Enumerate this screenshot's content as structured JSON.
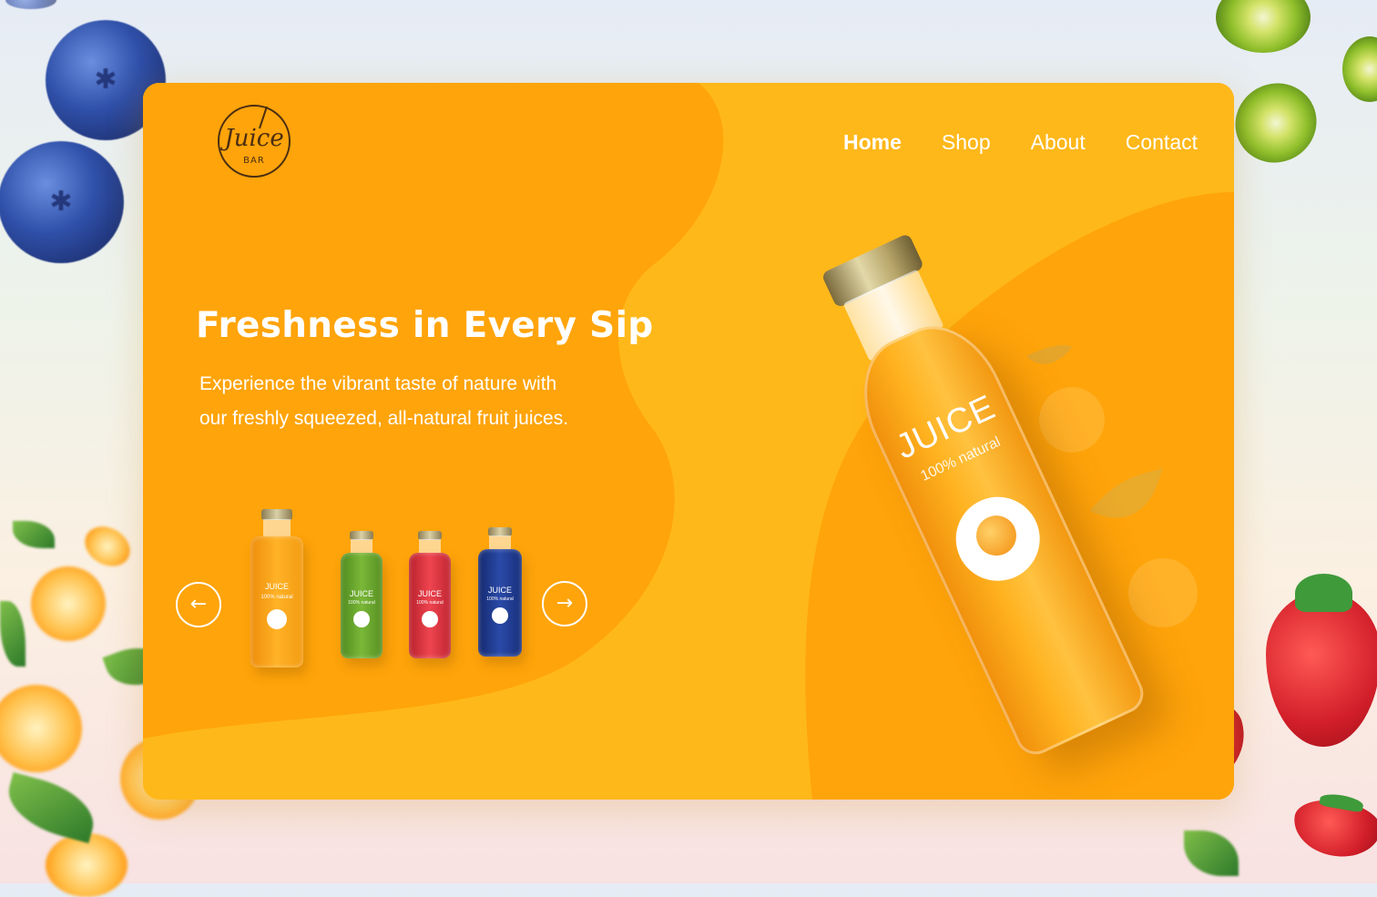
{
  "brand": {
    "logo_main": "Juice",
    "logo_sub": "BAR"
  },
  "nav": {
    "items": [
      "Home",
      "Shop",
      "About",
      "Contact"
    ],
    "active": "Home"
  },
  "hero": {
    "headline": "Freshness in Every Sip",
    "description": "Experience the vibrant taste of nature with our freshly squeezed, all-natural fruit juices."
  },
  "carousel": {
    "prev_icon": "arrow-left-icon",
    "next_icon": "arrow-right-icon",
    "bottles": [
      {
        "label": "JUICE",
        "sub": "100% natural",
        "color": "#f7a41a"
      },
      {
        "label": "JUICE",
        "sub": "100% natural",
        "color": "#6aa12e"
      },
      {
        "label": "JUICE",
        "sub": "100% natural",
        "color": "#d8313b"
      },
      {
        "label": "JUICE",
        "sub": "100% natural",
        "color": "#1e3a8a"
      }
    ]
  },
  "featured_bottle": {
    "label": "JUICE",
    "sub": "100% natural"
  },
  "colors": {
    "card_primary": "#ffb81a",
    "card_wave": "#ffa40a",
    "text": "#ffffff"
  }
}
